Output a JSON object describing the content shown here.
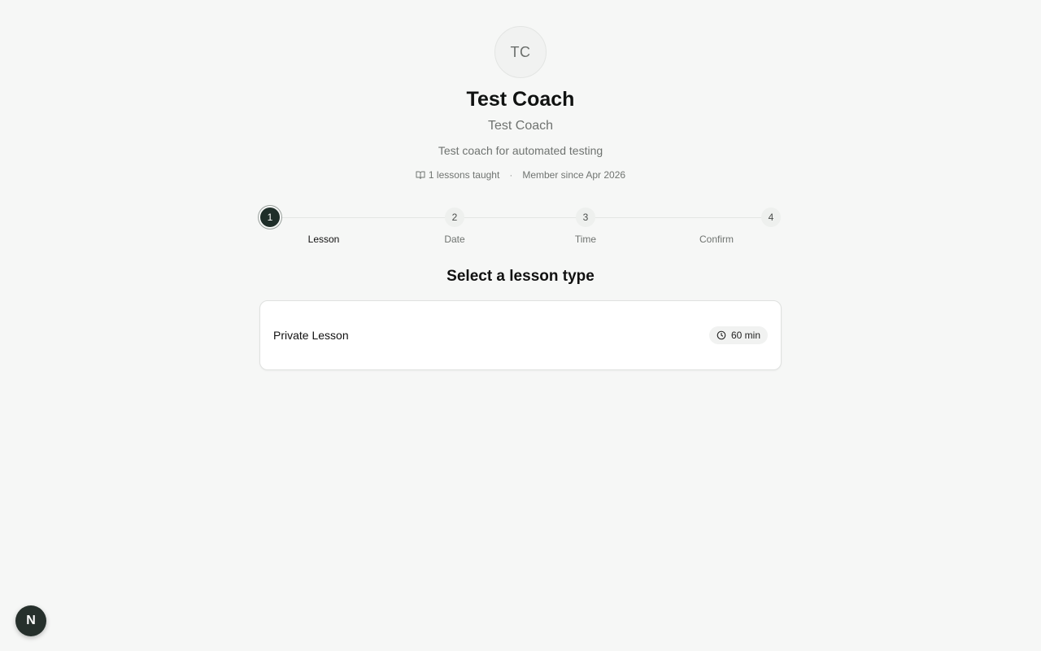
{
  "coach": {
    "initials": "TC",
    "name": "Test Coach",
    "title": "Test Coach",
    "bio": "Test coach for automated testing",
    "lessons_taught": "1 lessons taught",
    "separator": "·",
    "member_since": "Member since Apr 2026"
  },
  "stepper": {
    "steps": [
      {
        "number": "1",
        "label": "Lesson",
        "active": true
      },
      {
        "number": "2",
        "label": "Date",
        "active": false
      },
      {
        "number": "3",
        "label": "Time",
        "active": false
      },
      {
        "number": "4",
        "label": "Confirm",
        "active": false
      }
    ]
  },
  "main": {
    "section_title": "Select a lesson type",
    "lessons": [
      {
        "name": "Private Lesson",
        "duration": "60 min"
      }
    ]
  },
  "dev_badge": {
    "label": "N"
  },
  "icons": {
    "lessons": "book-open-icon",
    "duration": "clock-icon"
  },
  "colors": {
    "background": "#f6f7f6",
    "active_step": "#1f2e29"
  }
}
